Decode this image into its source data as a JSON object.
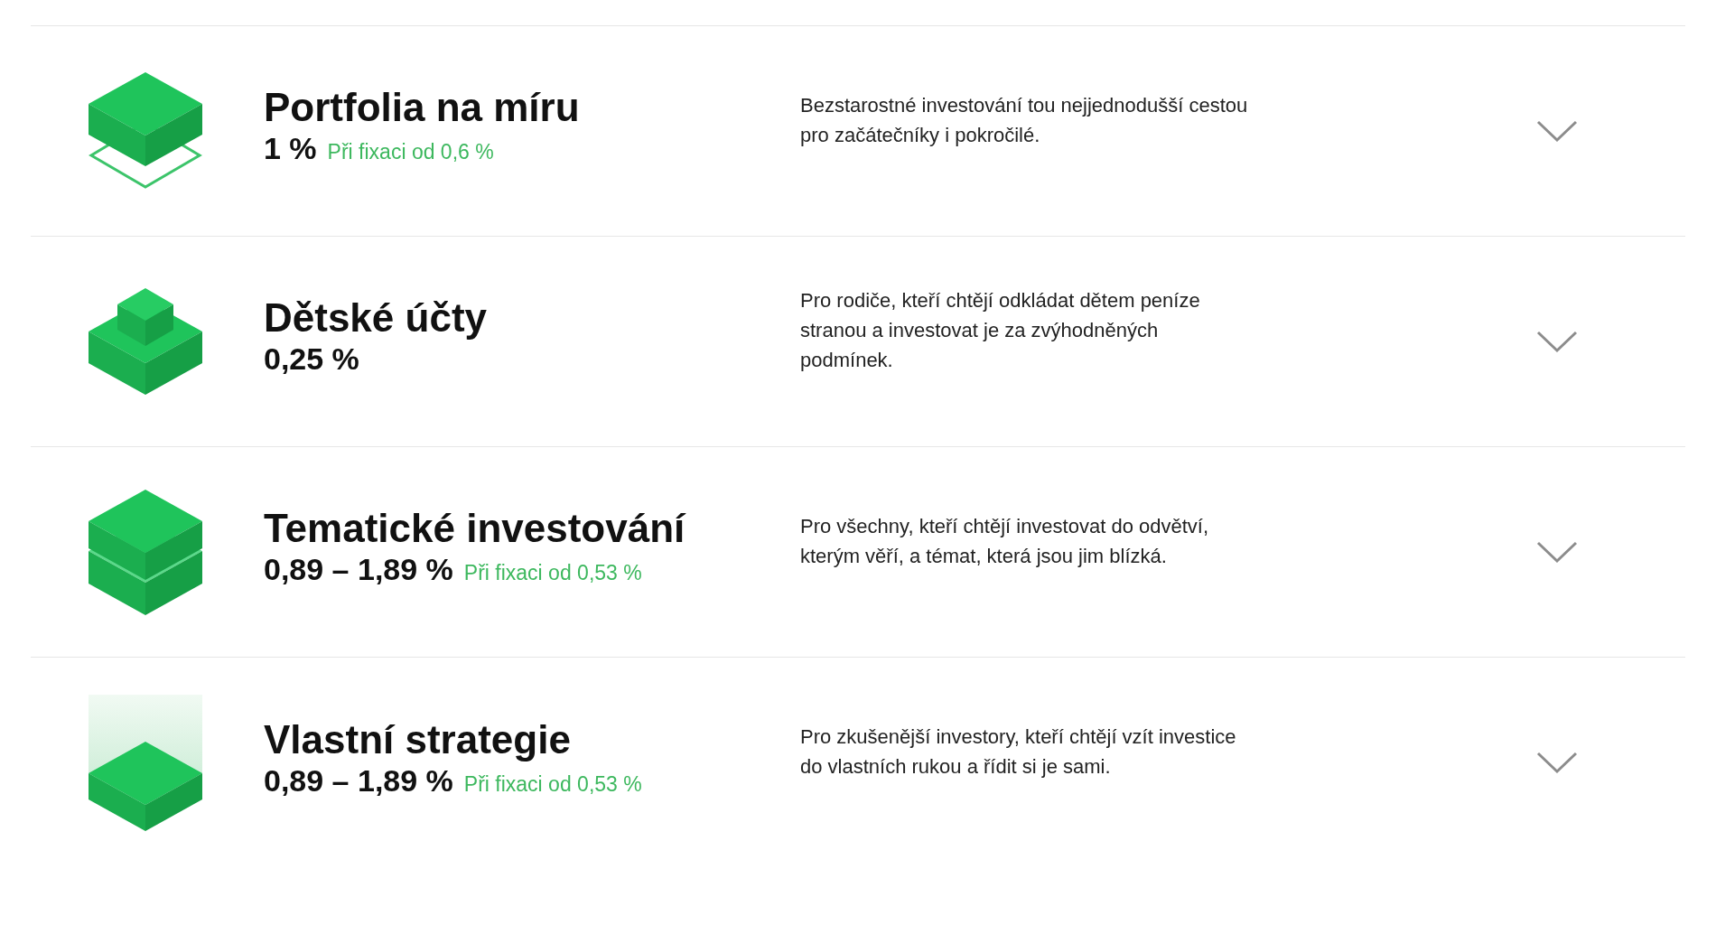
{
  "products": [
    {
      "title": "Portfolia na míru",
      "rate": "1 %",
      "fixed_rate_note": "Při fixaci od 0,6 %",
      "description": "Bezstarostné investování tou nejjednodušší cestou\npro začátečníky i pokročilé.",
      "expanded": false
    },
    {
      "title": "Dětské účty",
      "rate": "0,25 %",
      "description": "Pro rodiče, kteří chtějí odkládat dětem peníze\nstranou a investovat je za zvýhodněných\npodmínek.",
      "expanded": false
    },
    {
      "title": "Tematické investování",
      "rate": "0,89 – 1,89 %",
      "fixed_rate_note": "Při fixaci od 0,53 %",
      "description": "Pro všechny, kteří chtějí investovat do odvětví,\nkterým věří, a témat, která jsou jim blízká.",
      "expanded": false
    },
    {
      "title": "Vlastní strategie",
      "rate": "0,89 – 1,89 %",
      "fixed_rate_note": "Při fixaci od 0,53 %",
      "description": "Pro zkušenější investory, kteří chtějí vzít investice\ndo vlastních rukou a řídit si je sami.",
      "expanded": false
    }
  ]
}
